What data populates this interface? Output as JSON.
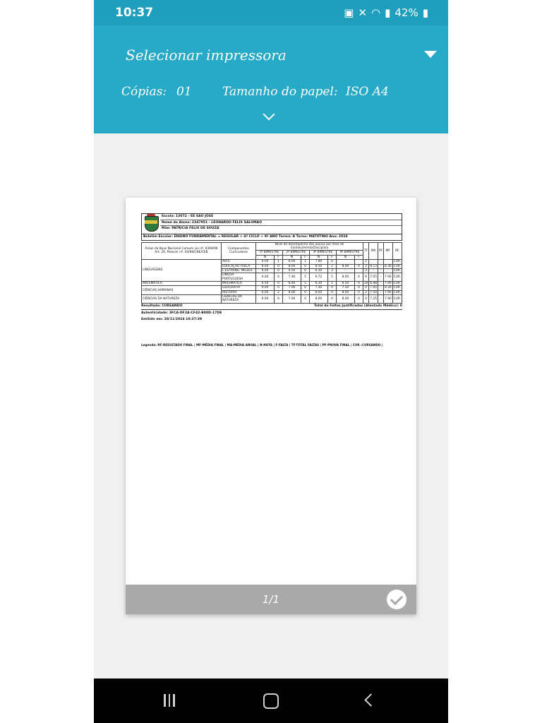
{
  "status_bar": {
    "time": "10:37",
    "battery": "42%"
  },
  "header": {
    "printer_label": "Selecionar impressora",
    "copies_label": "Cópias:",
    "copies_value": "01",
    "paper_label": "Tamanho do papel:",
    "paper_value": "ISO A4"
  },
  "preview": {
    "page_indicator": "1/1"
  },
  "document": {
    "escola": "Escola: 13072 - EE SAO JOSE",
    "aluno": "Nome do Aluno: 2347951 - LEONARDO FELIX SALOMAO",
    "mae": "Mãe: PATRICIA FELIX DE SOUZA",
    "boletim": "Boletim Escolar: ENSINO FUNDAMENTAL = REGULAR > 4º CICLO > 9º ANO Turma: A Turno: MATUTINO Ano: 2024",
    "col_area": "Áreas da Base Nacional Comum Lei nº. 9394/96 Art. 26, Parecer nº. 04/98/CNE/CEB",
    "col_comp": "Componentes Curriculares",
    "col_nivel": "Nível de desempenho dos alunos por Área de Conhecimento/Disciplina",
    "bimestres": [
      "1º BIMESTRE",
      "2º BIMESTRE",
      "3º BIMESTRE",
      "4º BIMESTRE"
    ],
    "col_tf": "TF",
    "col_ma": "MA",
    "col_pf": "PF",
    "col_mf": "MF",
    "col_rf": "RF",
    "sub_n": "N",
    "sub_f": "F",
    "rows": [
      {
        "area": "LINGUAGENS",
        "comp": "ARTE",
        "v": [
          "6.00",
          "1",
          "8.00",
          "1",
          "7.80",
          "0",
          "",
          "",
          "2",
          "",
          "",
          "",
          "CUR."
        ]
      },
      {
        "area": "",
        "comp": "EDUCAÇÃO FÍSICA",
        "v": [
          "8.00",
          "0",
          "8.00",
          "0",
          "8.50",
          "2",
          "8.00",
          "0",
          "2",
          "8.13",
          "-",
          "8.30",
          "CUR."
        ]
      },
      {
        "area": "",
        "comp": "L.ESTRANG. INGLÊS",
        "v": [
          "6.00",
          "0",
          "6.50",
          "0",
          "6.30",
          "3",
          "-",
          "",
          "3",
          "-",
          "-",
          "-",
          "CUR."
        ]
      },
      {
        "area": "",
        "comp": "LÍNGUA PORTUGUESA",
        "v": [
          "6.00",
          "0",
          "7.46",
          "5",
          "6.72",
          "1",
          "8.00",
          "0",
          "6",
          "7.05",
          "-",
          "7.90",
          "CUR."
        ]
      },
      {
        "area": "MATEMÁTICA",
        "comp": "MATEMÁTICA",
        "v": [
          "6.50",
          "0",
          "8.40",
          "5",
          "6.30",
          "5",
          "6.50",
          "0",
          "10",
          "6.98",
          "-",
          "7.90",
          "CUR."
        ]
      },
      {
        "area": "CIÊNCIAS HUMANAS",
        "comp": "GEOGRAFIA",
        "v": [
          "9.00",
          "0",
          "7.00",
          "0",
          "7.30",
          "0",
          "7.50",
          "0",
          "0",
          "7.65",
          "-",
          "8.30",
          "CUR."
        ]
      },
      {
        "area": "",
        "comp": "HISTÓRIA",
        "v": [
          "6.00",
          "2",
          "8.00",
          "0",
          "8.00",
          "0",
          "8.00",
          "0",
          "2",
          "7.50",
          "-",
          "7.90",
          "CUR."
        ]
      },
      {
        "area": "CIÊNCIAS DA NATUREZA",
        "comp": "CIÊNCIAS DA NATUREZA",
        "v": [
          "6.00",
          "0",
          "7.00",
          "0",
          "8.00",
          "0",
          "8.00",
          "0",
          "0",
          "7.25",
          "-",
          "7.90",
          "CUR."
        ]
      }
    ],
    "resultado": "Resultado: CURSANDO",
    "faltas": "Total de Faltas Justificadas (Atestado Médico): 0",
    "autenticidade": "Autenticidade: 3FCA-DF2A-CF42-B00D-17DE",
    "emitido": "Emitido em: 28/11/2024 10:37:39",
    "legenda": "Legenda: RF-RESULTADO FINAL | MF-MÉDIA FINAL | MA-MÉDIA ANUAL | N-NOTA | F-FALTA | TF-TOTAL FALTAS | PF-PROVA FINAL | CUR.-CURSANDO |"
  }
}
